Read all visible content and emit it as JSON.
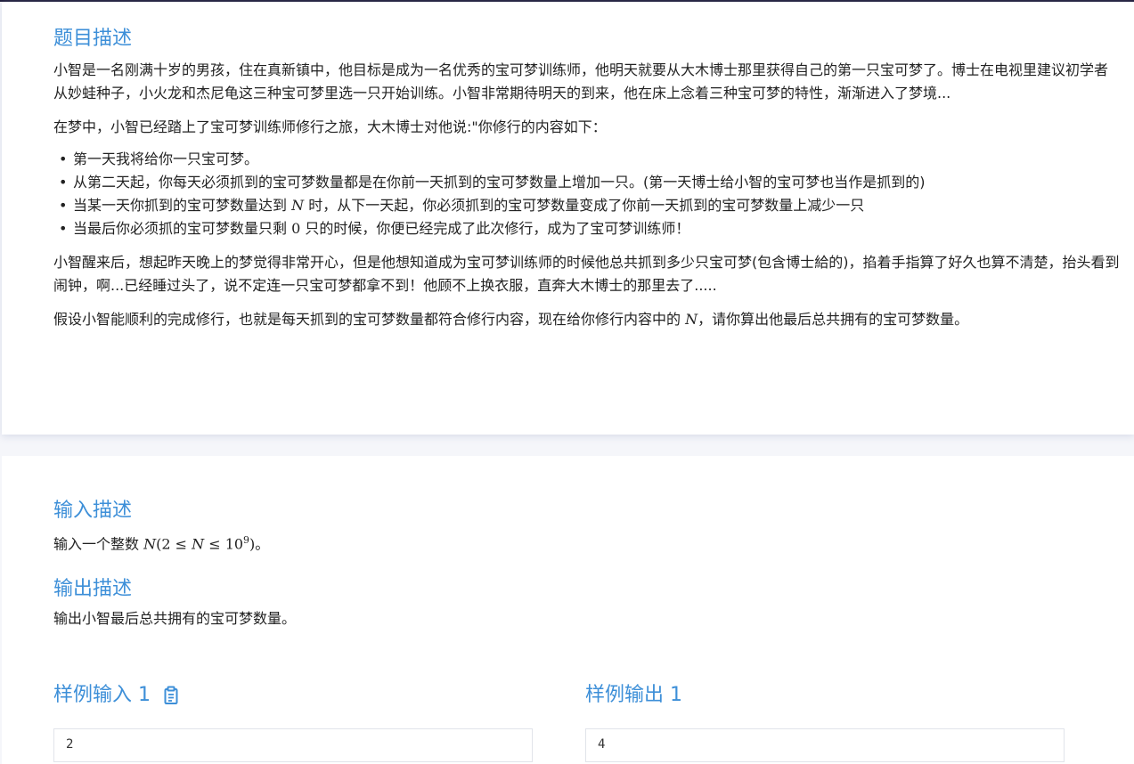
{
  "problem": {
    "title": "题目描述",
    "p1": "小智是一名刚满十岁的男孩，住在真新镇中，他目标是成为一名优秀的宝可梦训练师，他明天就要从大木博士那里获得自己的第一只宝可梦了。博士在电视里建议初学者从妙蛙种子，小火龙和杰尼龟这三种宝可梦里选一只开始训练。小智非常期待明天的到来，他在床上念着三种宝可梦的特性，渐渐进入了梦境...",
    "p2": "在梦中，小智已经踏上了宝可梦训练师修行之旅，大木博士对他说:\"你修行的内容如下：",
    "rule1": "第一天我将给你一只宝可梦。",
    "rule2": "从第二天起，你每天必须抓到的宝可梦数量都是在你前一天抓到的宝可梦数量上增加一只。(第一天博士给小智的宝可梦也当作是抓到的)",
    "rule3_a": "当某一天你抓到的宝可梦数量达到",
    "rule3_var": "N",
    "rule3_b": "时，从下一天起，你必须抓到的宝可梦数量变成了你前一天抓到的宝可梦数量上减少一只",
    "rule4_a": "当最后你必须抓的宝可梦数量只剩",
    "rule4_num": "0",
    "rule4_b": "只的时候，你便已经完成了此次修行，成为了宝可梦训练师！",
    "p3": "小智醒来后，想起昨天晚上的梦觉得非常开心，但是他想知道成为宝可梦训练师的时候他总共抓到多少只宝可梦(包含博士給的)，掐着手指算了好久也算不清楚，抬头看到闹钟，啊...已经睡过头了，说不定连一只宝可梦都拿不到！他顾不上换衣服，直奔大木博士的那里去了.....",
    "p4_a": "假设小智能顺利的完成修行，也就是每天抓到的宝可梦数量都符合修行内容，现在给你修行内容中的",
    "p4_var": "N",
    "p4_b": "，请你算出他最后总共拥有的宝可梦数量。"
  },
  "input": {
    "title": "输入描述",
    "text_a": "输入一个整数",
    "math_N": "N",
    "math_open": "(2 ≤ ",
    "math_N2": "N",
    "math_le": " ≤ 10",
    "math_exp": "9",
    "math_close": ")",
    "text_b": "。"
  },
  "output": {
    "title": "输出描述",
    "text": "输出小智最后总共拥有的宝可梦数量。"
  },
  "samples": {
    "input_title": "样例输入 1",
    "output_title": "样例输出 1",
    "input_value": "2",
    "output_value": "4",
    "accent_color": "#3d8fd8"
  }
}
